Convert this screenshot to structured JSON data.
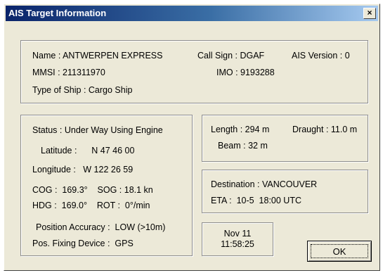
{
  "window": {
    "title": "AIS Target Information",
    "close_glyph": "×",
    "close_icon": "close-icon"
  },
  "identity": {
    "name": "Name : ANTWERPEN EXPRESS",
    "call_sign": "Call Sign : DGAF",
    "ais_version": "AIS Version : 0",
    "mmsi": "MMSI : 211311970",
    "imo": "IMO : 9193288",
    "type_of_ship": "Type of Ship :  Cargo Ship"
  },
  "navigation": {
    "status": "Status : Under Way Using Engine",
    "latitude": "Latitude :      N 47 46 00",
    "longitude": "Longitude :   W 122 26 59",
    "cog_sog": "COG :  169.3°    SOG : 18.1 kn",
    "hdg_rot": "HDG :  169.0°    ROT :  0°/min",
    "position_accuracy": "Position Accuracy :  LOW (>10m)",
    "pos_fixing_device": "Pos. Fixing Device :  GPS"
  },
  "dimensions": {
    "length": "Length : 294 m",
    "draught": "Draught : 11.0 m",
    "beam": "Beam : 32 m"
  },
  "voyage": {
    "destination": "Destination : VANCOUVER",
    "eta": "ETA :  10-5  18:00 UTC"
  },
  "timestamp": {
    "date": "Nov 11",
    "time": "11:58:25"
  },
  "buttons": {
    "ok": "OK"
  }
}
